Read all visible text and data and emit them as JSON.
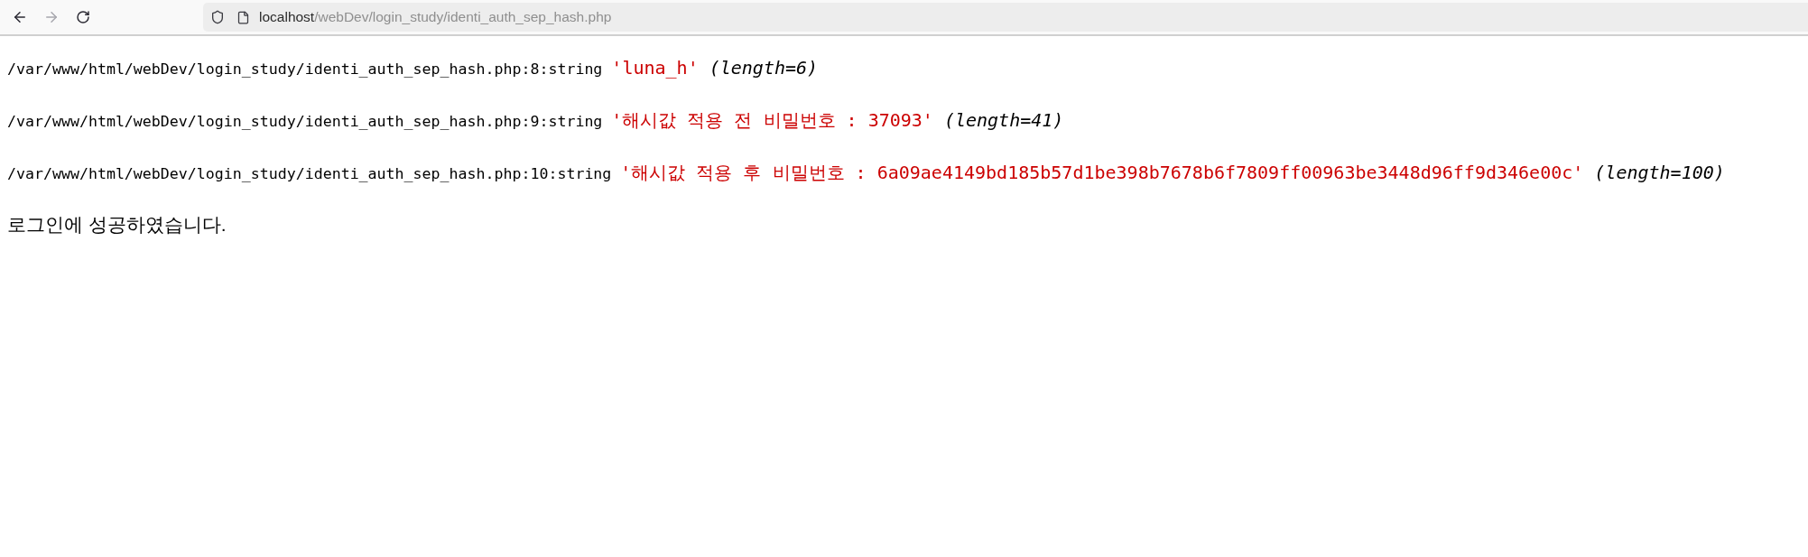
{
  "toolbar": {
    "nav_buttons": [
      {
        "kind": "back",
        "disabled": false
      },
      {
        "kind": "forward",
        "disabled": true
      },
      {
        "kind": "reload",
        "disabled": false
      }
    ],
    "address_bar": {
      "host": "localhost",
      "path": "/webDev/login_study/identi_auth_sep_hash.php"
    }
  },
  "dumps": [
    {
      "source": "/var/www/html/webDev/login_study/identi_auth_sep_hash.php:8:string",
      "value": "'luna_h'",
      "length": "(length=6)"
    },
    {
      "source": "/var/www/html/webDev/login_study/identi_auth_sep_hash.php:9:string",
      "value": "'해시값 적용 전 비밀번호 : 37093'",
      "length": "(length=41)"
    },
    {
      "source": "/var/www/html/webDev/login_study/identi_auth_sep_hash.php:10:string",
      "value": "'해시값 적용 후 비밀번호 : 6a09ae4149bd185b57d1be398b7678b6f7809ff00963be3448d96ff9d346e00c'",
      "length": "(length=100)"
    }
  ],
  "message": "로그인에 성공하였습니다."
}
